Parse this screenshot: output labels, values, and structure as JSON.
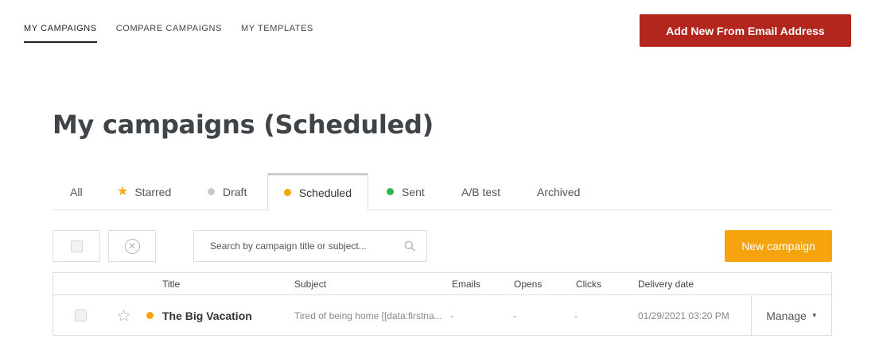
{
  "topnav": {
    "items": [
      {
        "label": "MY CAMPAIGNS",
        "active": true
      },
      {
        "label": "COMPARE CAMPAIGNS",
        "active": false
      },
      {
        "label": "MY TEMPLATES",
        "active": false
      }
    ],
    "add_email_button": "Add New From Email Address"
  },
  "page_title": "My campaigns (Scheduled)",
  "tabs": [
    {
      "label": "All",
      "icon": null
    },
    {
      "label": "Starred",
      "icon": "star-icon",
      "color": "#f4a913"
    },
    {
      "label": "Draft",
      "icon": "dot",
      "color": "#c8c8c8"
    },
    {
      "label": "Scheduled",
      "icon": "dot",
      "color": "#f6a40e",
      "active": true
    },
    {
      "label": "Sent",
      "icon": "dot",
      "color": "#2eb84b"
    },
    {
      "label": "A/B test",
      "icon": null
    },
    {
      "label": "Archived",
      "icon": null
    }
  ],
  "toolbar": {
    "search_placeholder": "Search by campaign title or subject...",
    "new_campaign_button": "New campaign"
  },
  "table": {
    "columns": [
      "Title",
      "Subject",
      "Emails",
      "Opens",
      "Clicks",
      "Delivery date"
    ],
    "rows": [
      {
        "status_color": "#f6a40e",
        "title": "The Big Vacation",
        "subject": "Tired of being home [[data:firstna...",
        "emails": "-",
        "opens": "-",
        "clicks": "-",
        "delivery_date": "01/29/2021 03:20 PM",
        "manage_label": "Manage"
      }
    ]
  },
  "colors": {
    "brand_red": "#b3261e",
    "accent_orange": "#f6a40e",
    "sent_green": "#2eb84b"
  }
}
